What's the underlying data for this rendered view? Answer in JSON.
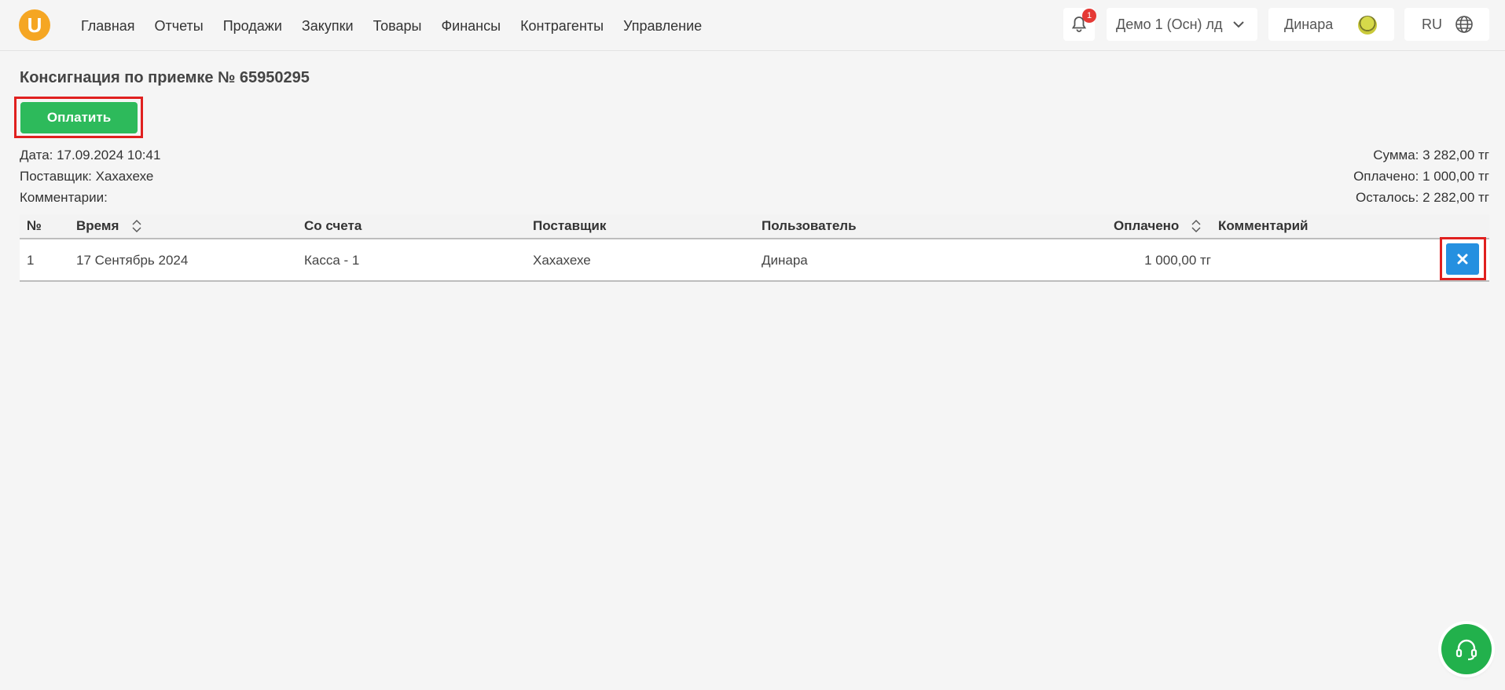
{
  "header": {
    "logo_letter": "U",
    "nav": [
      "Главная",
      "Отчеты",
      "Продажи",
      "Закупки",
      "Товары",
      "Финансы",
      "Контрагенты",
      "Управление"
    ],
    "notification_count": "1",
    "organization": "Демо 1 (Осн) лд",
    "user_name": "Динара",
    "language": "RU"
  },
  "page": {
    "title": "Консигнация по приемке № 65950295",
    "pay_button": "Оплатить",
    "info_left": [
      "Дата: 17.09.2024 10:41",
      "Поставщик: Хахахехе",
      "Комментарии:"
    ],
    "info_right": [
      "Сумма: 3 282,00 тг",
      "Оплачено: 1 000,00 тг",
      "Осталось: 2 282,00 тг"
    ]
  },
  "table": {
    "headers": [
      "№",
      "Время",
      "Со счета",
      "Поставщик",
      "Пользователь",
      "Оплачено",
      "Комментарий"
    ],
    "rows": [
      [
        "1",
        "17 Сентябрь 2024",
        "Касса - 1",
        "Хахахехе",
        "Динара",
        "1 000,00 тг",
        ""
      ]
    ]
  },
  "colors": {
    "accent_green": "#2dba5b",
    "delete_blue": "#2590e0",
    "highlight_red": "#e0201f",
    "logo_orange": "#f5a623"
  },
  "icons": [
    "bell-icon",
    "chevron-down-icon",
    "globe-icon",
    "sort-icon",
    "close-icon",
    "headset-icon"
  ]
}
